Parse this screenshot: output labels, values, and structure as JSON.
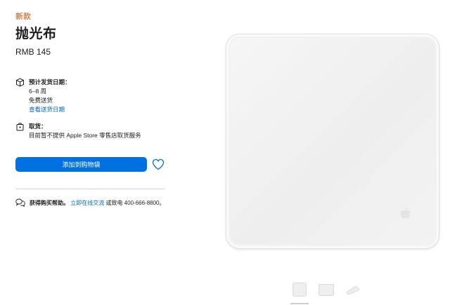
{
  "product": {
    "badge": "新款",
    "title": "抛光布",
    "price": "RMB 145"
  },
  "shipping": {
    "header": "预计发货日期：",
    "time": "6–8 周",
    "free": "免费送货",
    "link": "查看送货日期",
    "icon": "box-icon"
  },
  "pickup": {
    "header": "取货：",
    "text": "目前暂不提供 Apple Store 零售店取货服务",
    "icon": "store-bag-icon"
  },
  "actions": {
    "add_to_bag": "添加到购物袋",
    "favorite_icon": "heart-icon"
  },
  "help": {
    "header": "获得购买帮助。",
    "link": "立即在线交流",
    "text": " 或致电 400-666-8800。",
    "icon": "chat-bubbles-icon"
  },
  "colors": {
    "accent": "#0071e3",
    "link": "#0066cc",
    "badge": "#bf4800"
  }
}
